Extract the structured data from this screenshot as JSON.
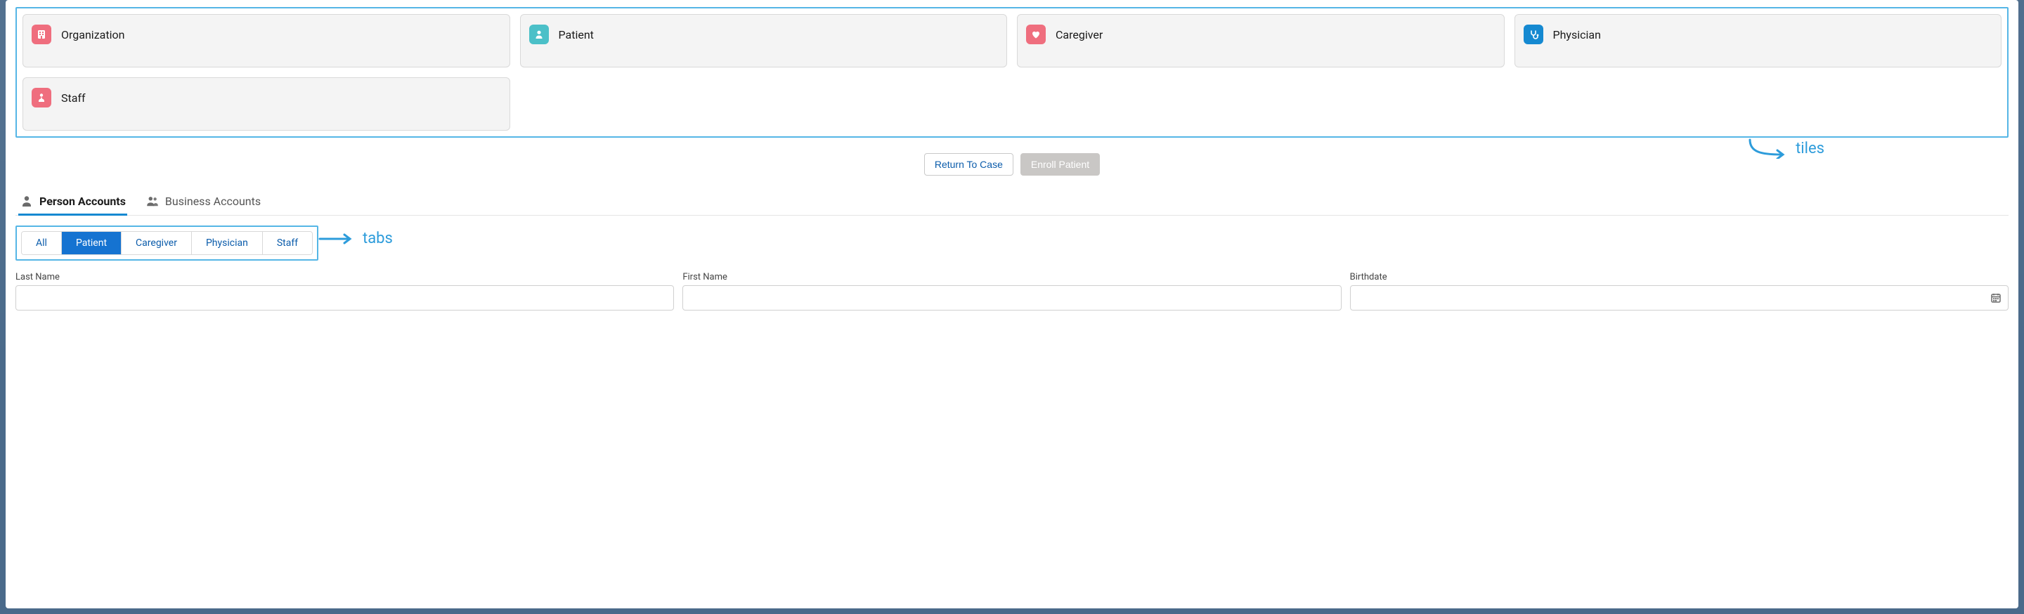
{
  "tiles": [
    {
      "label": "Organization",
      "icon": "building-icon",
      "iconColor": "icon-pink"
    },
    {
      "label": "Patient",
      "icon": "person-icon",
      "iconColor": "icon-teal"
    },
    {
      "label": "Caregiver",
      "icon": "heart-icon",
      "iconColor": "icon-pink"
    },
    {
      "label": "Physician",
      "icon": "stethoscope-icon",
      "iconColor": "icon-blue"
    },
    {
      "label": "Staff",
      "icon": "staff-icon",
      "iconColor": "icon-pink"
    }
  ],
  "actions": {
    "return_label": "Return To Case",
    "enroll_label": "Enroll Patient"
  },
  "typeTabs": {
    "person_label": "Person Accounts",
    "business_label": "Business Accounts",
    "active": "person"
  },
  "filterTabs": {
    "items": [
      "All",
      "Patient",
      "Caregiver",
      "Physician",
      "Staff"
    ],
    "active": "Patient"
  },
  "fields": {
    "lastName": {
      "label": "Last Name",
      "value": ""
    },
    "firstName": {
      "label": "First Name",
      "value": ""
    },
    "birthdate": {
      "label": "Birthdate",
      "value": ""
    }
  },
  "annotations": {
    "tiles": "tiles",
    "tabs": "tabs"
  },
  "colors": {
    "highlight": "#55b6e6",
    "annotation": "#2d9cdb",
    "primaryBlue": "#1573d1"
  }
}
